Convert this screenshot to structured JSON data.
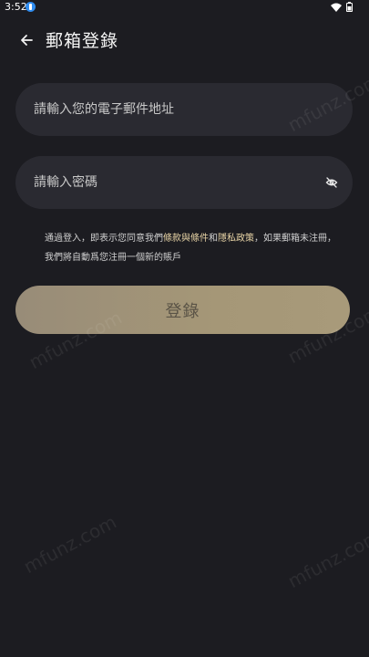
{
  "status_bar": {
    "time": "3:52"
  },
  "header": {
    "title": "郵箱登錄"
  },
  "email": {
    "placeholder": "請輸入您的電子郵件地址"
  },
  "password": {
    "placeholder": "請輸入密碼"
  },
  "terms": {
    "prefix": "通過登入，即表示您同意我們",
    "terms_link": "條款與條件",
    "conjunction": "和",
    "privacy_link": "隱私政策",
    "suffix": "，如果郵箱未注冊，我們將自動爲您注冊一個新的賬戶"
  },
  "login_button": {
    "label": "登錄"
  },
  "watermark": {
    "text": "mfunz.com"
  },
  "colors": {
    "background": "#1c1c21",
    "field": "#2a2a31",
    "link": "#e8d4a6",
    "button": "#a59777"
  }
}
